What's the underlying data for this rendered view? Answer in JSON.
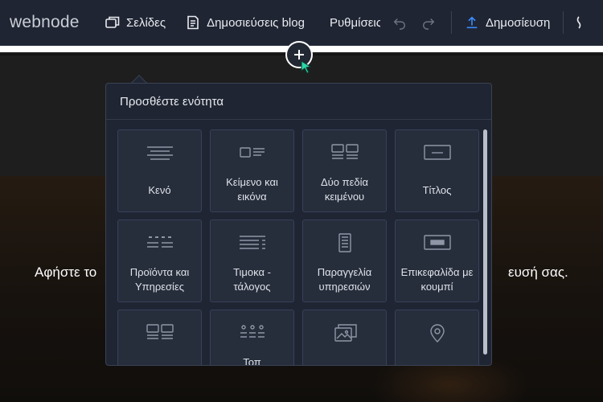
{
  "toolbar": {
    "logo": "webnode",
    "pages_label": "Σελίδες",
    "blog_label": "Δημοσιεύσεις blog",
    "settings_label": "Ρυθμίσεις",
    "publish_label": "Δημοσίευση"
  },
  "hero": {
    "left_text": "Αφήστε το",
    "right_text": "ευσή σας."
  },
  "panel": {
    "title": "Προσθέστε ενότητα",
    "tiles": [
      {
        "label": "Κενό",
        "icon": "blank-section-icon"
      },
      {
        "label": "Κείμενο και εικόνα",
        "icon": "text-image-icon"
      },
      {
        "label": "Δύο πεδία κειμένου",
        "icon": "two-text-fields-icon"
      },
      {
        "label": "Τίτλος",
        "icon": "title-icon"
      },
      {
        "label": "Προϊόντα και Υπηρεσίες",
        "icon": "products-services-icon"
      },
      {
        "label": "Τιμοκα - τάλογος",
        "icon": "price-list-icon"
      },
      {
        "label": "Παραγγελία υπηρεσιών",
        "icon": "service-order-icon"
      },
      {
        "label": "Επικεφαλίδα με κουμπί",
        "icon": "header-button-icon"
      },
      {
        "label": "",
        "icon": "gallery-grid-icon"
      },
      {
        "label": "Τοπ",
        "icon": "team-icon"
      },
      {
        "label": "",
        "icon": "photos-icon"
      },
      {
        "label": "",
        "icon": "map-pin-icon"
      }
    ]
  },
  "colors": {
    "toolbar_bg": "#1f2532",
    "panel_bg": "#1f2532",
    "tile_bg": "#262d3b",
    "accent_blue": "#3b8bff",
    "cursor": "#2dd4a7"
  }
}
